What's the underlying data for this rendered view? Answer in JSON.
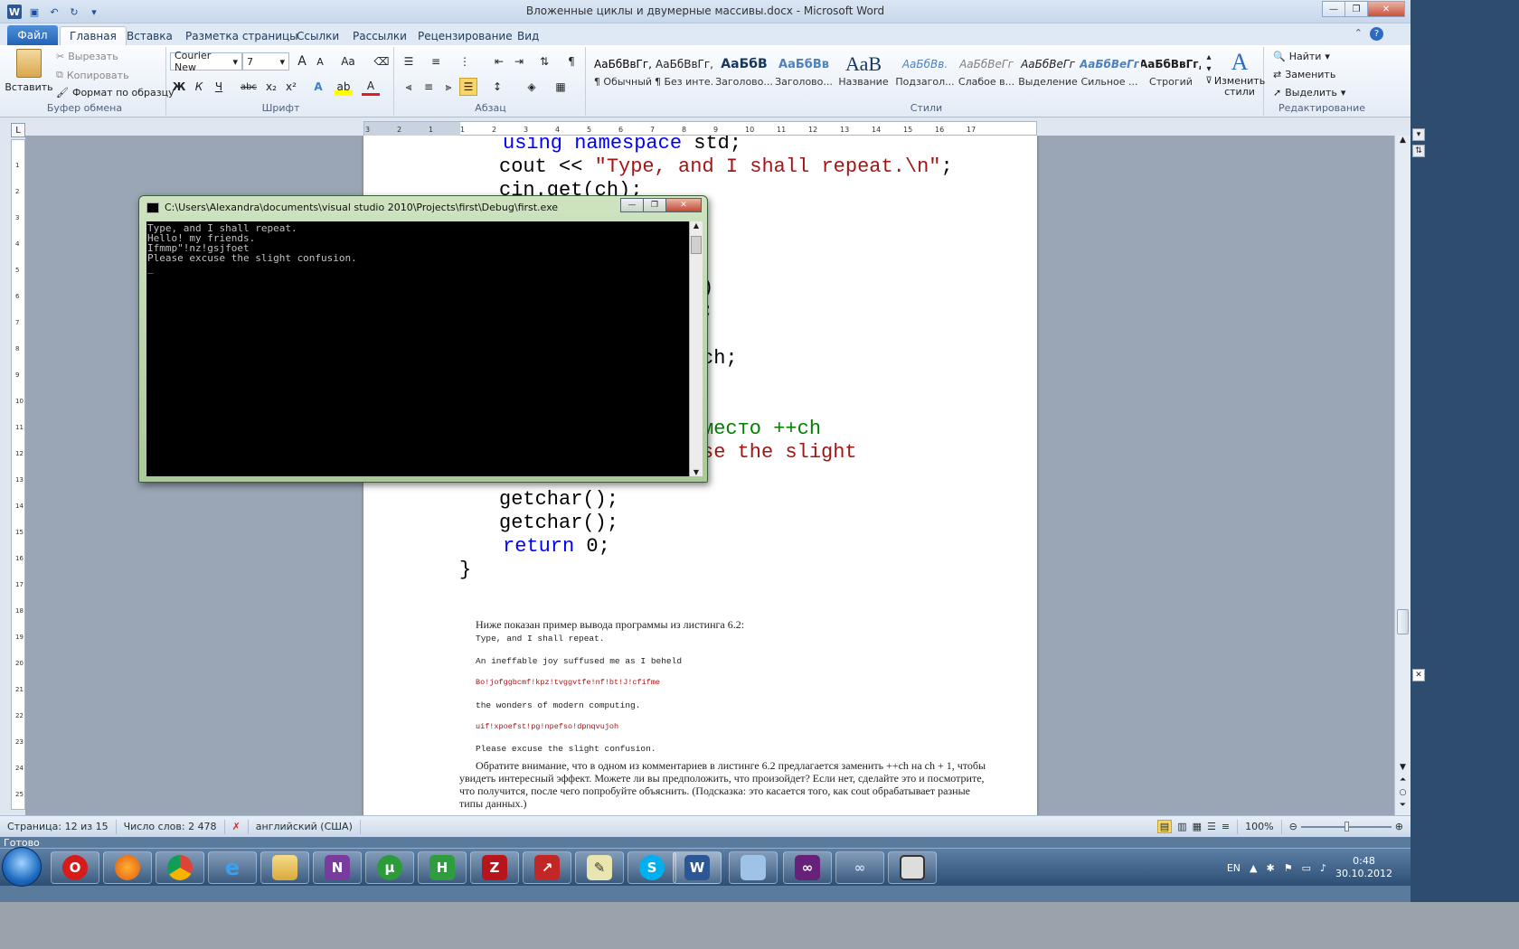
{
  "window": {
    "title": "Вложенные циклы и двумерные массивы.docx - Microsoft Word"
  },
  "tabs": {
    "file": "Файл",
    "items": [
      "Главная",
      "Вставка",
      "Разметка страницы",
      "Ссылки",
      "Рассылки",
      "Рецензирование",
      "Вид"
    ]
  },
  "clipboard": {
    "paste": "Вставить",
    "cut": "Вырезать",
    "copy": "Копировать",
    "format_painter": "Формат по образцу",
    "label": "Буфер обмена"
  },
  "font": {
    "name": "Courier New",
    "size": "7",
    "label": "Шрифт",
    "bold": "Ж",
    "italic": "К",
    "underline": "Ч",
    "strike": "abc",
    "sub": "x₂",
    "sup": "x²",
    "grow": "A",
    "shrink": "A",
    "case": "Aa"
  },
  "paragraph": {
    "label": "Абзац"
  },
  "styles": {
    "label": "Стили",
    "change": "Изменить стили",
    "items": [
      {
        "sample": "АаБбВвГг,",
        "name": "¶ Обычный",
        "color": "#000000"
      },
      {
        "sample": "АаБбВвГг,",
        "name": "¶ Без инте...",
        "color": "#000000"
      },
      {
        "sample": "АаБбВ",
        "name": "Заголово...",
        "color": "#17365d"
      },
      {
        "sample": "АаБбВв",
        "name": "Заголово...",
        "color": "#4f81bd"
      },
      {
        "sample": "АаВ",
        "name": "Название",
        "color": "#17365d"
      },
      {
        "sample": "АаБбВв.",
        "name": "Подзагол...",
        "color": "#4f81bd"
      },
      {
        "sample": "АаБбВеГг",
        "name": "Слабое в...",
        "color": "#808080"
      },
      {
        "sample": "АаБбВеГг",
        "name": "Выделение",
        "color": "#000000"
      },
      {
        "sample": "АаБбВеГг",
        "name": "Сильное ...",
        "color": "#4f81bd"
      },
      {
        "sample": "АаБбВвГг,",
        "name": "Строгий",
        "color": "#000000"
      }
    ]
  },
  "editing": {
    "label": "Редактирование",
    "find": "Найти",
    "replace": "Заменить",
    "select": "Выделить"
  },
  "code": {
    "line1_kw": "using namespace",
    "line1_rest": " std;",
    "line2_a": "cout << ",
    "line2_str": "\"Type, and I shall repeat.\\n\"",
    "line2_b": ";",
    "line3": "cin.get(ch);",
    "frag1": ")",
    "frag2": ";",
    "frag3": "ch;",
    "frag4": "место ++ch",
    "frag5": "se the slight",
    "line_gc1": "getchar();",
    "line_gc2": "getchar();",
    "line_ret_kw": "return",
    "line_ret_rest": " 0;",
    "line_brace": "}"
  },
  "doc": {
    "intro": "Ниже показан пример вывода программы из листинга 6.2:",
    "out": [
      "Type, and I shall repeat.",
      "An ineffable joy suffused me as I beheld",
      "Bo!jofggbcmf!kpz!tvggvtfe!nf!bt!J!cfifme",
      "the wonders of modern computing.",
      "uif!xpoefst!pg!npefso!dpnqvujoh",
      "Please excuse the slight confusion."
    ],
    "para": [
      "Обратите внимание, что в одном из комментариев в листинге 6.2 предлагается заменить ++ch на ch + 1, чтобы",
      "увидеть интересный эффект. Можете ли вы предположить, что произойдет? Если нет, сделайте это и посмотрите,",
      "что получится, после чего попробуйте объяснить. (Подсказка: это касается того, как cout обрабатывает разные",
      "типы данных.)"
    ]
  },
  "status": {
    "page": "Страница: 12 из 15",
    "words": "Число слов: 2 478",
    "lang": "английский (США)",
    "zoom": "100%",
    "ready": "Готово"
  },
  "console": {
    "title": "C:\\Users\\Alexandra\\documents\\visual studio 2010\\Projects\\first\\Debug\\first.exe",
    "lines": [
      "Type, and I shall repeat.",
      "Hello! my friends.",
      "Ifmmp\"!nz!gsjfoet",
      "Please excuse the slight confusion.",
      "_"
    ]
  },
  "tray": {
    "lang": "EN",
    "time": "0:48",
    "date": "30.10.2012"
  },
  "ruler": {
    "numbers": [
      "3",
      "2",
      "1",
      "1",
      "2",
      "3",
      "4",
      "5",
      "6",
      "7",
      "8",
      "9",
      "10",
      "11",
      "12",
      "13",
      "14",
      "15",
      "16",
      "17"
    ],
    "vnumbers": [
      "1",
      "2",
      "3",
      "4",
      "5",
      "6",
      "7",
      "8",
      "9",
      "10",
      "11",
      "12",
      "13",
      "14",
      "15",
      "16",
      "17",
      "18",
      "19",
      "20",
      "21",
      "22",
      "23",
      "24",
      "25"
    ]
  }
}
